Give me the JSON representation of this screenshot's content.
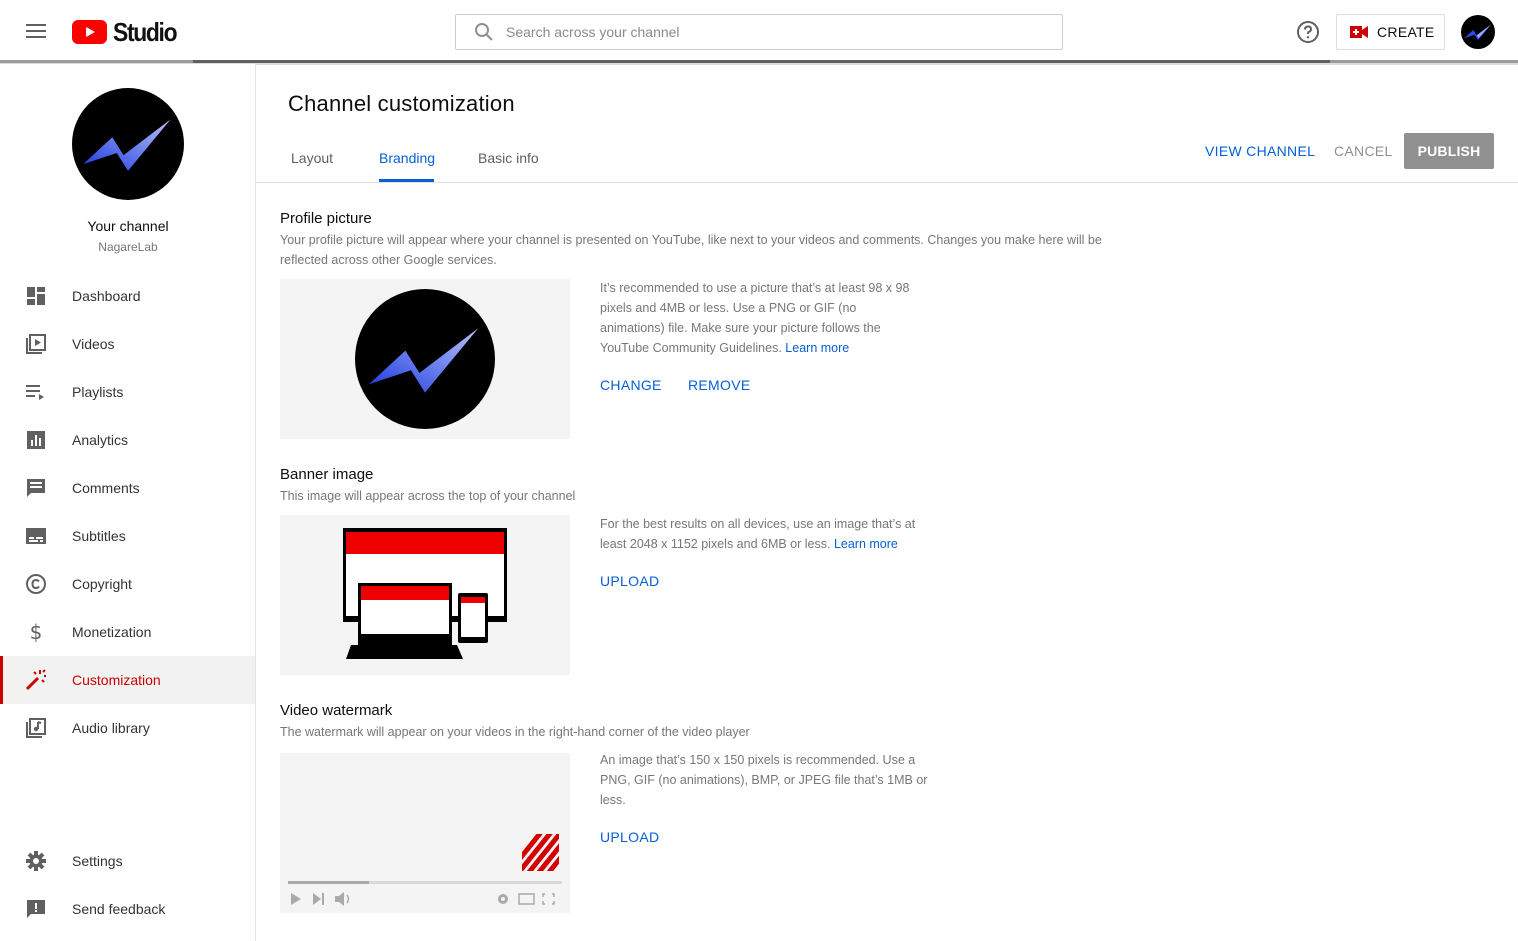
{
  "header": {
    "logo_text": "Studio",
    "search_placeholder": "Search across your channel",
    "create_label": "CREATE"
  },
  "sidebar": {
    "channel_title": "Your channel",
    "channel_name": "NagareLab",
    "items": [
      {
        "label": "Dashboard",
        "icon": "dashboard-icon"
      },
      {
        "label": "Videos",
        "icon": "videos-icon"
      },
      {
        "label": "Playlists",
        "icon": "playlists-icon"
      },
      {
        "label": "Analytics",
        "icon": "analytics-icon"
      },
      {
        "label": "Comments",
        "icon": "comments-icon"
      },
      {
        "label": "Subtitles",
        "icon": "subtitles-icon"
      },
      {
        "label": "Copyright",
        "icon": "copyright-icon"
      },
      {
        "label": "Monetization",
        "icon": "dollar-icon"
      },
      {
        "label": "Customization",
        "icon": "magic-wand-icon",
        "active": true
      },
      {
        "label": "Audio library",
        "icon": "audio-library-icon"
      }
    ],
    "bottom_items": [
      {
        "label": "Settings",
        "icon": "gear-icon"
      },
      {
        "label": "Send feedback",
        "icon": "feedback-icon"
      }
    ]
  },
  "main": {
    "title": "Channel customization",
    "tabs": [
      {
        "label": "Layout"
      },
      {
        "label": "Branding",
        "active": true
      },
      {
        "label": "Basic info"
      }
    ],
    "actions": {
      "view_channel": "VIEW CHANNEL",
      "cancel": "CANCEL",
      "publish": "PUBLISH"
    },
    "profile": {
      "title": "Profile picture",
      "desc_line1": "Your profile picture will appear where your channel is presented on YouTube, like next to your videos and comments. Changes you make here will be",
      "desc_line2": "reflected across other Google services.",
      "info_line1": "It’s recommended to use a picture that’s at least 98 x 98",
      "info_line2": "pixels and 4MB or less. Use a PNG or GIF (no",
      "info_line3": "animations) file. Make sure your picture follows the",
      "info_line4": "YouTube Community Guidelines.",
      "learn_more": "Learn more",
      "change": "CHANGE",
      "remove": "REMOVE"
    },
    "banner": {
      "title": "Banner image",
      "desc": "This image will appear across the top of your channel",
      "info_line1": "For the best results on all devices, use an image that’s at",
      "info_line2": "least 2048 x 1152 pixels and 6MB or less.",
      "learn_more": "Learn more",
      "upload": "UPLOAD"
    },
    "watermark": {
      "title": "Video watermark",
      "desc": "The watermark will appear on your videos in the right-hand corner of the video player",
      "info_line1": "An image that’s 150 x 150 pixels is recommended. Use a",
      "info_line2": "PNG, GIF (no animations), BMP, or JPEG file that’s 1MB or",
      "info_line3": "less.",
      "upload": "UPLOAD"
    }
  },
  "colors": {
    "accent": "#065fd4",
    "brand_red": "#cc0000",
    "publish_disabled": "#909090"
  }
}
